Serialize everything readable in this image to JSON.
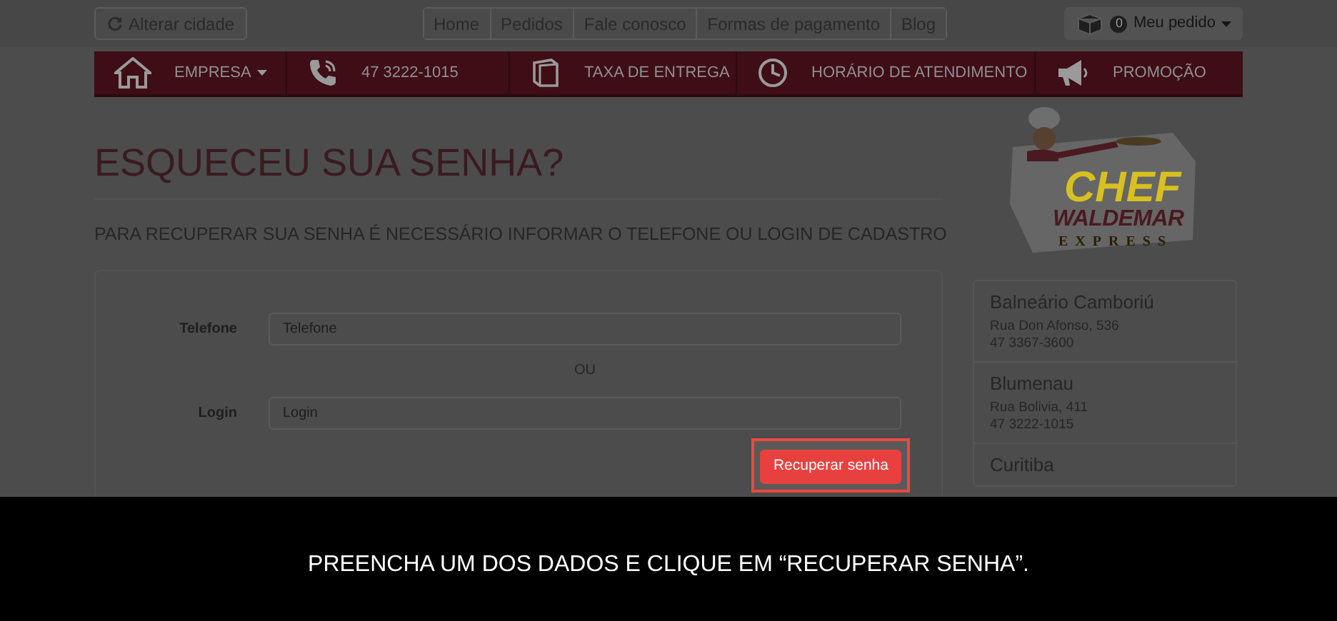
{
  "top_bar": {
    "city_button": "Alterar cidade",
    "links": [
      "Home",
      "Pedidos",
      "Fale conosco",
      "Formas de pagamento",
      "Blog"
    ],
    "order": {
      "count": "0",
      "label": "Meu pedido"
    }
  },
  "nav": [
    {
      "kind": "house",
      "label": "EMPRESA",
      "dropdown": true
    },
    {
      "kind": "phone",
      "label": "47 3222-1015",
      "dropdown": false
    },
    {
      "kind": "box",
      "label": "TAXA DE ENTREGA",
      "dropdown": false
    },
    {
      "kind": "clock",
      "label": "HORÁRIO DE ATENDIMENTO",
      "dropdown": false
    },
    {
      "kind": "megaphone",
      "label": "PROMOÇÃO",
      "dropdown": false
    }
  ],
  "heading": "ESQUECEU SUA SENHA?",
  "instructions": "PARA RECUPERAR SUA SENHA É NECESSÁRIO INFORMAR O TELEFONE OU LOGIN DE CADASTRO",
  "form": {
    "fields": [
      {
        "label": "Telefone",
        "placeholder": "Telefone"
      },
      {
        "label": "Login",
        "placeholder": "Login"
      }
    ],
    "separator": "OU",
    "submit": "Recuperar senha"
  },
  "logo": {
    "line1": "CHEF",
    "line2": "WALDEMAR",
    "line3": "EXPRESS"
  },
  "stores": [
    {
      "city": "Balneário Camboriú",
      "address": "Rua Don Afonso, 536",
      "phone": "47 3367-3600"
    },
    {
      "city": "Blumenau",
      "address": "Rua Bolivia, 411",
      "phone": "47 3222-1015"
    },
    {
      "city": "Curitiba"
    }
  ],
  "caption": "PREENCHA UM DOS DADOS E CLIQUE EM “RECUPERAR SENHA”."
}
